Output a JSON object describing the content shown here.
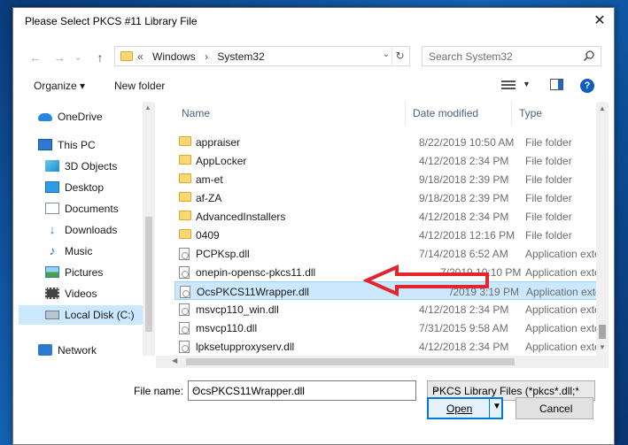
{
  "window": {
    "title": "Please Select PKCS #11 Library File"
  },
  "navigation": {
    "back_label": "←",
    "forward_label": "→",
    "recent_label": "⌄",
    "up_label": "↑",
    "address_prefix": "«",
    "breadcrumb": [
      "Windows",
      "System32"
    ],
    "search_placeholder": "Search System32"
  },
  "toolbar": {
    "organize_label": "Organize ▾",
    "new_folder_label": "New folder"
  },
  "sidebar": {
    "items": [
      {
        "label": "OneDrive",
        "icon": "cloud-icon"
      },
      {
        "label": "This PC",
        "icon": "computer-icon"
      },
      {
        "label": "3D Objects",
        "icon": "3d-objects-icon"
      },
      {
        "label": "Desktop",
        "icon": "desktop-icon"
      },
      {
        "label": "Documents",
        "icon": "documents-icon"
      },
      {
        "label": "Downloads",
        "icon": "downloads-icon"
      },
      {
        "label": "Music",
        "icon": "music-icon"
      },
      {
        "label": "Pictures",
        "icon": "pictures-icon"
      },
      {
        "label": "Videos",
        "icon": "videos-icon"
      },
      {
        "label": "Local Disk (C:)",
        "icon": "local-disk-icon",
        "selected": true
      },
      {
        "label": "Network",
        "icon": "network-icon"
      }
    ]
  },
  "file_list": {
    "columns": [
      "Name",
      "Date modified",
      "Type"
    ],
    "rows": [
      {
        "name": "appraiser",
        "date": "8/22/2019 10:50 AM",
        "type": "File folder",
        "kind": "folder"
      },
      {
        "name": "AppLocker",
        "date": "4/12/2018 2:34 PM",
        "type": "File folder",
        "kind": "folder"
      },
      {
        "name": "am-et",
        "date": "9/18/2018 2:39 PM",
        "type": "File folder",
        "kind": "folder"
      },
      {
        "name": "af-ZA",
        "date": "9/18/2018 2:39 PM",
        "type": "File folder",
        "kind": "folder"
      },
      {
        "name": "AdvancedInstallers",
        "date": "4/12/2018 2:34 PM",
        "type": "File folder",
        "kind": "folder"
      },
      {
        "name": "0409",
        "date": "4/12/2018 12:16 PM",
        "type": "File folder",
        "kind": "folder"
      },
      {
        "name": "PCPKsp.dll",
        "date": "7/14/2018 6:52 AM",
        "type": "Application exten",
        "kind": "dll"
      },
      {
        "name": "onepin-opensc-pkcs11.dll",
        "date": "7/2019 10:10 PM",
        "type": "Application exten",
        "kind": "dll"
      },
      {
        "name": "OcsPKCS11Wrapper.dll",
        "date": "/2019 3:19 PM",
        "type": "Application exten",
        "kind": "dll",
        "selected": true
      },
      {
        "name": "msvcp110_win.dll",
        "date": "4/12/2018 2:34 PM",
        "type": "Application exten",
        "kind": "dll"
      },
      {
        "name": "msvcp110.dll",
        "date": "7/31/2015 9:58 AM",
        "type": "Application exten",
        "kind": "dll"
      },
      {
        "name": "lpksetupproxyserv.dll",
        "date": "4/12/2018 2:34 PM",
        "type": "Application exten",
        "kind": "dll"
      }
    ]
  },
  "bottom": {
    "file_name_label": "File name:",
    "file_name_value": "OcsPKCS11Wrapper.dll",
    "filter_value": "PKCS Library Files (*pkcs*.dll;*p",
    "open_label": "Open",
    "cancel_label": "Cancel"
  },
  "colors": {
    "selection": "#cce8ff",
    "selection_border": "#99d1ff",
    "annotation_arrow": "#e3262e",
    "accent": "#0078d7"
  }
}
